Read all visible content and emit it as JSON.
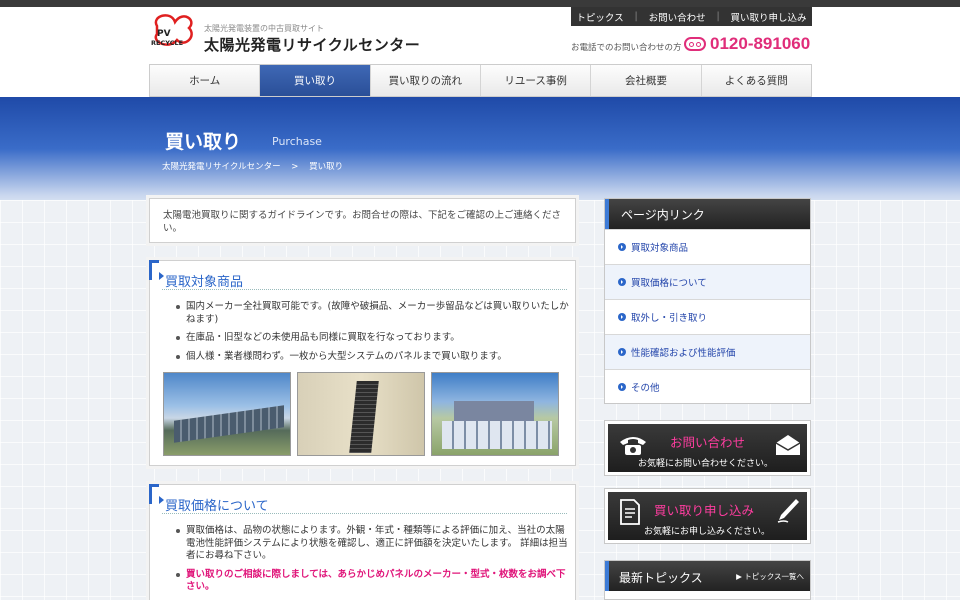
{
  "header": {
    "logo_text": "PV RECYCLE",
    "site_subtitle": "太陽光発電装置の中古買取サイト",
    "site_title": "太陽光発電リサイクルセンター",
    "top_links": [
      "トピックス",
      "お問い合わせ",
      "買い取り申し込み"
    ],
    "tel_label": "お電話でのお問い合わせの方",
    "tel_number": "0120-891060"
  },
  "nav": {
    "items": [
      "ホーム",
      "買い取り",
      "買い取りの流れ",
      "リユース事例",
      "会社概要",
      "よくある質問"
    ],
    "active": "買い取り"
  },
  "hero": {
    "title": "買い取り",
    "title_en": "Purchase",
    "breadcrumb": [
      "太陽光発電リサイクルセンター",
      ">",
      "買い取り"
    ]
  },
  "intro": "太陽電池買取りに関するガイドラインです。お問合せの際は、下記をご確認の上ご連絡ください。",
  "section1": {
    "title": "買取対象商品",
    "items": [
      "国内メーカー全社買取可能です。(故障や破損品、メーカー歩留品などは買い取りいたしかねます)",
      "在庫品・旧型などの未使用品も同様に買取を行なっております。",
      "個人様・業者様問わず。一枚から大型システムのパネルまで買い取ります。"
    ]
  },
  "section2": {
    "title": "買取価格について",
    "items": [
      "買取価格は、品物の状態によります。外観・年式・種類等による評価に加え、当社の太陽電池性能評価システムにより状態を確認し、適正に評価額を決定いたします。 詳細は担当者にお尋ね下さい。",
      "買い取りのご相談に際しましては、あらかじめパネルのメーカー・型式・枚数をお調べ下さい。"
    ]
  },
  "sidebar": {
    "links_title": "ページ内リンク",
    "links": [
      "買取対象商品",
      "買取価格について",
      "取外し・引き取り",
      "性能確認および性能評価",
      "その他"
    ],
    "cta_contact": {
      "main": "お問い合わせ",
      "sub": "お気軽にお問い合わせください。"
    },
    "cta_apply": {
      "main": "買い取り申し込み",
      "sub": "お気軽にお申し込みください。"
    },
    "topics_title": "最新トピックス",
    "topics_more": "トピックス一覧へ"
  },
  "colors": {
    "accent": "#2b66c9",
    "pink": "#e02d7a",
    "nav_active": "#2f559f"
  }
}
